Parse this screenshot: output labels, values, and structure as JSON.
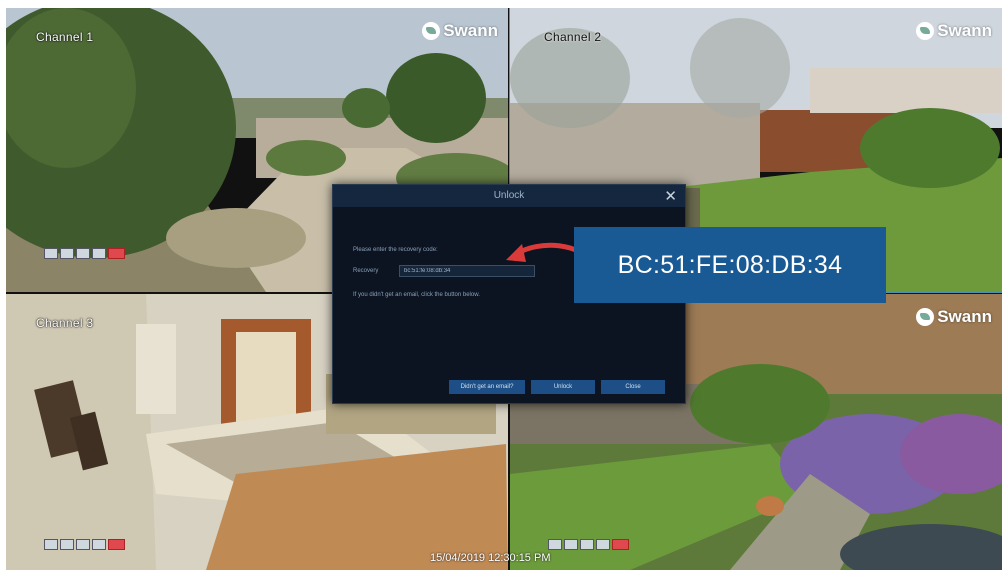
{
  "channels": [
    {
      "label": "Channel 1"
    },
    {
      "label": "Channel 2"
    },
    {
      "label": "Channel 3"
    },
    {
      "label": ""
    }
  ],
  "logo": {
    "text": "Swann"
  },
  "timestamp": "15/04/2019 12:30:15 PM",
  "dialog": {
    "title": "Unlock",
    "line_prompt": "Please enter the recovery code:",
    "field_label": "Recovery",
    "field_value": "bc:51:fe:08:db:34",
    "hint": "If you didn't get an email, click the button below.",
    "buttons": [
      "Didn't get an email?",
      "Unlock",
      "Close"
    ]
  },
  "callout": {
    "text": "BC:51:FE:08:DB:34"
  },
  "colors": {
    "accent": "#1a5a94",
    "dialog_bg": "#0b1420",
    "record": "#e04850"
  }
}
